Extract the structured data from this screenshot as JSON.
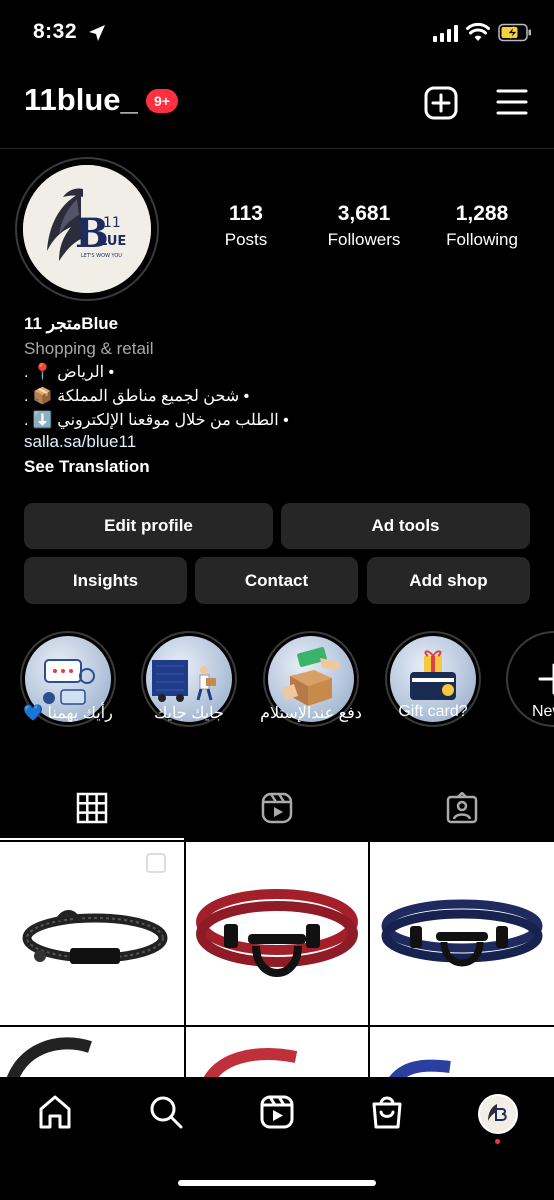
{
  "status_bar": {
    "time": "8:32"
  },
  "header": {
    "username": "11blue_",
    "notification_count": "9+"
  },
  "profile": {
    "stats": [
      {
        "number": "113",
        "label": "Posts"
      },
      {
        "number": "3,681",
        "label": "Followers"
      },
      {
        "number": "1,288",
        "label": "Following"
      }
    ],
    "display_name": "متجر 11Blue",
    "category": "Shopping & retail",
    "bio_lines": [
      "• الرياض 📍 .",
      "• شحن لجميع مناطق المملكة 📦 .",
      "• الطلب من خلال موقعنا الإلكتروني ⬇️ ."
    ],
    "link": "salla.sa/blue11",
    "see_translation": "See Translation",
    "logo_text": {
      "b": "B",
      "num": "11",
      "lue": "LUE",
      "tagline": "LET'S WOW YOU"
    }
  },
  "buttons": {
    "edit_profile": "Edit profile",
    "ad_tools": "Ad tools",
    "insights": "Insights",
    "contact": "Contact",
    "add_shop": "Add shop"
  },
  "highlights": [
    {
      "label": "💙 رأيك يهمنا"
    },
    {
      "label": "جايك جايك"
    },
    {
      "label": "دفع عندالإستلام"
    },
    {
      "label": "Gift card?"
    },
    {
      "label": "New"
    }
  ],
  "colors": {
    "background": "#000000",
    "button_bg": "#262626",
    "badge_red": "#ff3040",
    "muted_text": "#a8a8a8",
    "bracelet_red": "#a3202b",
    "bracelet_navy": "#1f2a5e"
  }
}
